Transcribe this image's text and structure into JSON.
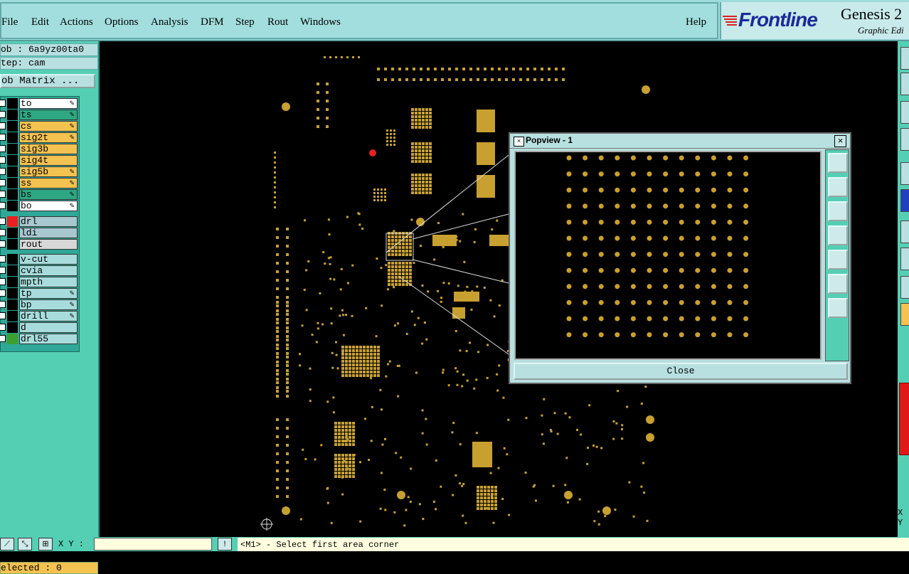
{
  "menubar": {
    "items": [
      "File",
      "Edit",
      "Actions",
      "Options",
      "Analysis",
      "DFM",
      "Step",
      "Rout",
      "Windows",
      "Help"
    ]
  },
  "brand": {
    "logo": "Frontline",
    "title": "Genesis 2",
    "subtitle": "Graphic Edi"
  },
  "job": {
    "job_text": "ob : 6a9yz00ta0",
    "step_text": "tep: cam",
    "matrix_button": "ob Matrix ..."
  },
  "layers": [
    {
      "name": "to",
      "color": "#ffffff",
      "editable": true
    },
    {
      "name": "ts",
      "color": "#2ea882",
      "editable": true
    },
    {
      "name": "cs",
      "color": "#f4c250",
      "editable": true
    },
    {
      "name": "sig2t",
      "color": "#f4c250",
      "editable": true
    },
    {
      "name": "sig3b",
      "color": "#f4c250",
      "editable": false
    },
    {
      "name": "sig4t",
      "color": "#f4c250",
      "editable": false
    },
    {
      "name": "sig5b",
      "color": "#f4c250",
      "editable": true
    },
    {
      "name": "ss",
      "color": "#f4c250",
      "editable": true
    },
    {
      "name": "bs",
      "color": "#2ea882",
      "editable": true
    },
    {
      "name": "bo",
      "color": "#ffffff",
      "editable": true
    },
    {
      "name": "drl",
      "color": "#a8c8d0",
      "editable": false
    },
    {
      "name": "ldi",
      "color": "#a8c8d0",
      "editable": false
    },
    {
      "name": "rout",
      "color": "#d8d8d8",
      "editable": false
    },
    {
      "name": "v-cut",
      "color": "#a8dcdc",
      "editable": false
    },
    {
      "name": "cvia",
      "color": "#a8dcdc",
      "editable": false
    },
    {
      "name": "mpth",
      "color": "#a8dcdc",
      "editable": false
    },
    {
      "name": "tp",
      "color": "#a8dcdc",
      "editable": true
    },
    {
      "name": "bp",
      "color": "#a8dcdc",
      "editable": true
    },
    {
      "name": "drill",
      "color": "#a8dcdc",
      "editable": true
    },
    {
      "name": "d",
      "color": "#a8dcdc",
      "editable": false
    },
    {
      "name": "drl55",
      "color": "#a8dcdc",
      "editable": false
    }
  ],
  "selected_text": "elected : 0",
  "status": {
    "xy_label": "X Y :",
    "message": "<M1> - Select first area corner"
  },
  "popview": {
    "title": "Popview - 1",
    "close_label": "Close"
  },
  "colors": {
    "pad": "#c8a030",
    "panel": "#55cfb4",
    "menubar": "#a2dede",
    "highlight_red": "#e82020"
  }
}
